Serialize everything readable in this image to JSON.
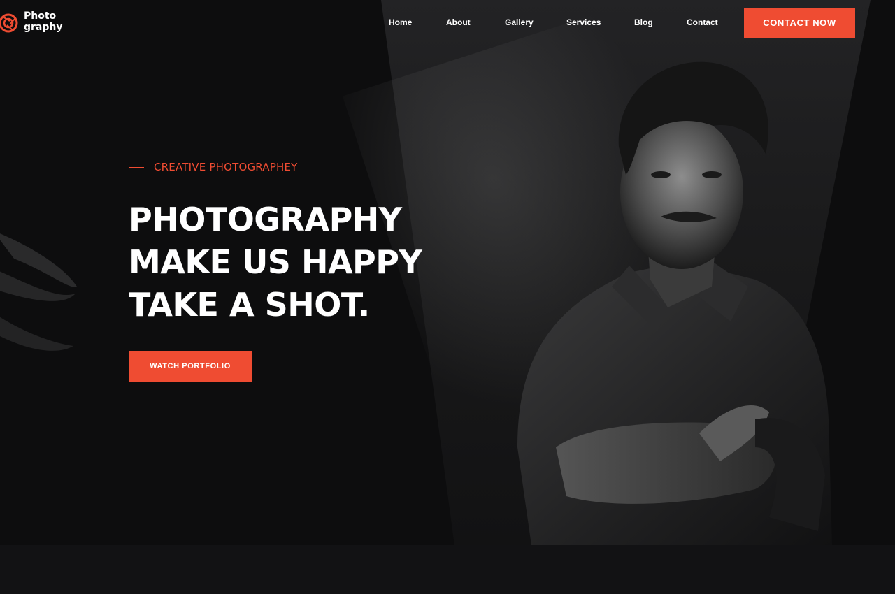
{
  "brand": {
    "name_line1": "Photo",
    "name_line2": "graphy",
    "logo_icon": "camera-aperture-icon",
    "accent_color": "#ef4c32"
  },
  "nav": {
    "items": [
      {
        "label": "Home"
      },
      {
        "label": "About"
      },
      {
        "label": "Gallery"
      },
      {
        "label": "Services"
      },
      {
        "label": "Blog"
      },
      {
        "label": "Contact"
      }
    ],
    "cta_label": "CONTACT NOW"
  },
  "hero": {
    "eyebrow": "CREATIVE PHOTOGRAPHEY",
    "headline": [
      "PHOTOGRAPHY",
      "MAKE US HAPPY",
      "TAKE A SHOT."
    ],
    "button_label": "WATCH PORTFOLIO",
    "image": "portrait-of-man-with-crossed-arms"
  }
}
